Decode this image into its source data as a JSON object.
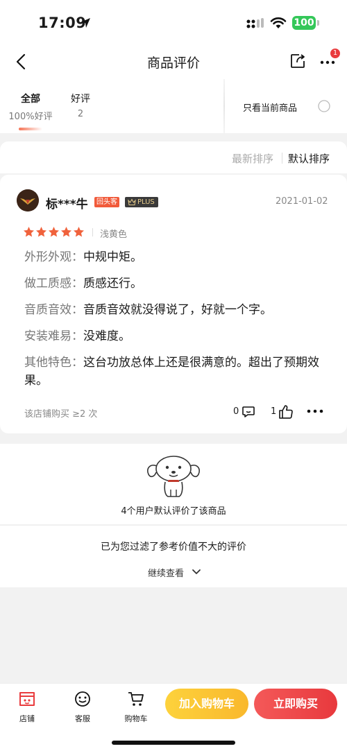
{
  "status_bar": {
    "time": "17:09",
    "battery": "100"
  },
  "nav": {
    "title": "商品评价",
    "notification_count": "1"
  },
  "filters": {
    "tabs": [
      {
        "label": "全部",
        "sub": "100%好评"
      },
      {
        "label": "好评",
        "sub": "2"
      }
    ],
    "only_current_label": "只看当前商品"
  },
  "sort": {
    "newest": "最新排序",
    "default": "默认排序"
  },
  "review": {
    "user_name": "标***牛",
    "badge_head": "回头客",
    "badge_plus": "PLUS",
    "date": "2021-01-02",
    "rating": 5,
    "spec": "浅黄色",
    "lines": [
      {
        "label": "外形外观：",
        "text": "中规中矩。"
      },
      {
        "label": "做工质感：",
        "text": "质感还行。"
      },
      {
        "label": "音质音效：",
        "text": "音质音效就没得说了，好就一个字。"
      },
      {
        "label": "安装难易：",
        "text": "没难度。"
      },
      {
        "label": "其他特色：",
        "text": "这台功放总体上还是很满意的。超出了预期效果。"
      }
    ],
    "purchase_count": "该店铺购买 ≥2 次",
    "comments": "0",
    "likes": "1"
  },
  "default_reviews": "4个用户默认评价了该商品",
  "filtered_notice": "已为您过滤了参考价值不大的评价",
  "continue_view": "继续查看",
  "bottom": {
    "shop": "店铺",
    "service": "客服",
    "cart": "购物车",
    "add_to_cart": "加入购物车",
    "buy_now": "立即购买"
  },
  "colors": {
    "accent_red": "#e93b3d",
    "star_orange": "#f0623c",
    "cart_yellow": "#fdd23c"
  }
}
